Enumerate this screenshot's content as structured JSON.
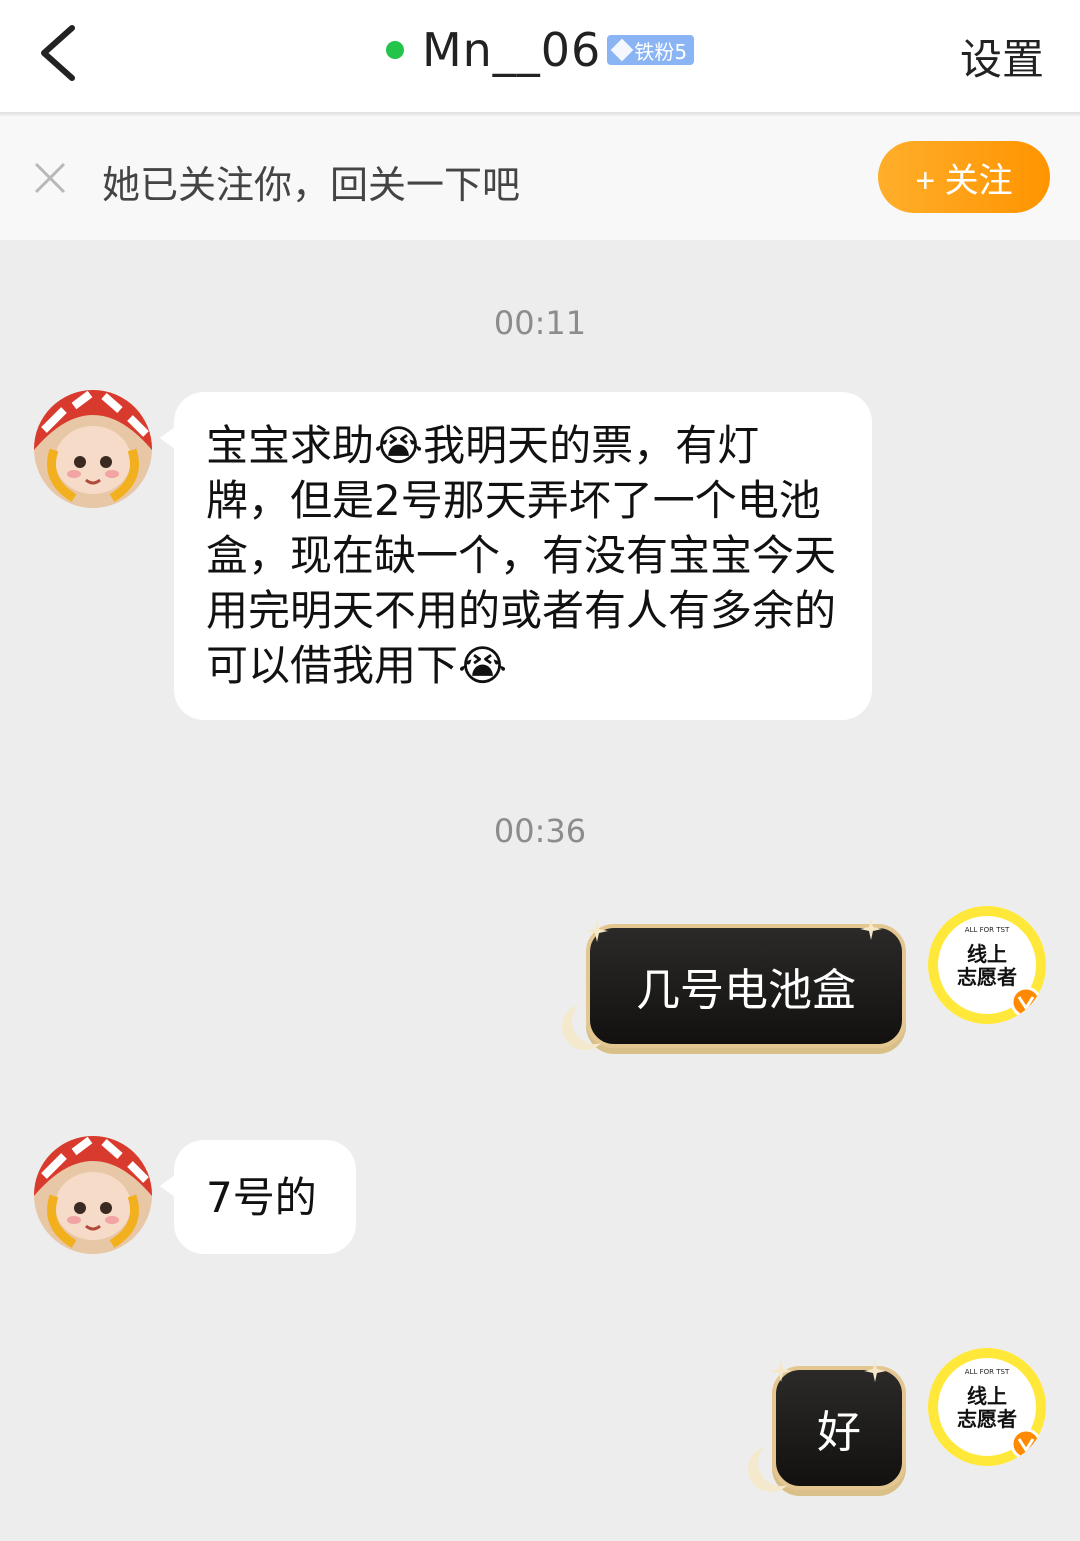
{
  "header": {
    "name": "Mn__06",
    "badge": "铁粉5",
    "settings_label": "设置"
  },
  "follow_bar": {
    "text": "她已关注你，回关一下吧",
    "button_label": "+ 关注"
  },
  "messages": [
    {
      "time": "00:11"
    },
    {
      "text": "宝宝求助😭我明天的票，有灯牌，但是2号那天弄坏了一个电池盒，现在缺一个，有没有宝宝今天用完明天不用的或者有人有多余的可以借我用下😭"
    },
    {
      "time": "00:36"
    },
    {
      "text": "几号电池盒"
    },
    {
      "text": "7号的"
    },
    {
      "text": "好"
    }
  ],
  "avatar_right": {
    "line1": "ALL FOR TST",
    "line2": "线上",
    "line3": "志愿者"
  },
  "colors": {
    "accent": "#ff9f1a",
    "online": "#24c34a",
    "badge": "#8ab4f4"
  }
}
